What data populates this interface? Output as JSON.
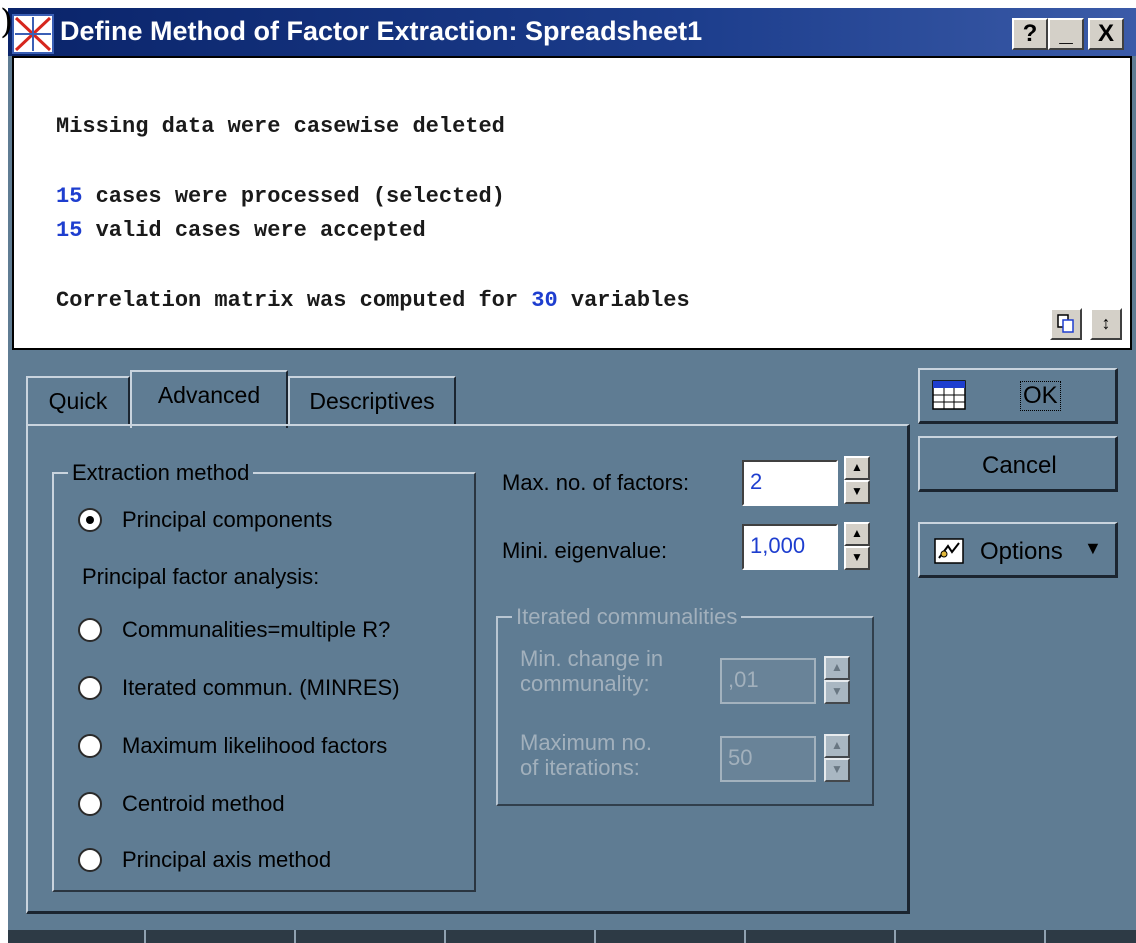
{
  "window": {
    "stray_char": ")",
    "title": "Define Method of Factor Extraction: Spreadsheet1",
    "help_label": "?",
    "minimize_label": "_",
    "close_label": "X"
  },
  "output": {
    "line1": "Missing data were casewise deleted",
    "line2_num": "15",
    "line2_text": " cases were processed (selected)",
    "line3_num": "15",
    "line3_text": " valid cases were accepted",
    "line4_text": "Correlation matrix was computed for ",
    "line4_num": "30",
    "line4_tail": " variables"
  },
  "tabs": [
    {
      "label": "Quick"
    },
    {
      "label": "Advanced"
    },
    {
      "label": "Descriptives"
    }
  ],
  "extraction": {
    "legend": "Extraction method",
    "principal_components": "Principal components",
    "pfa_label": "Principal factor analysis:",
    "options": [
      {
        "label": "Communalities=multiple R?"
      },
      {
        "label": "Iterated commun. (MINRES)"
      },
      {
        "label": "Maximum likelihood factors"
      },
      {
        "label": "Centroid method"
      },
      {
        "label": "Principal axis method"
      }
    ]
  },
  "params": {
    "max_factors_label": "Max. no. of factors:",
    "max_factors_value": "2",
    "min_eigen_label": "Mini. eigenvalue:",
    "min_eigen_value": "1,000"
  },
  "iterated": {
    "legend": "Iterated communalities",
    "min_change_label_1": "Min. change in",
    "min_change_label_2": "communality:",
    "min_change_value": ",01",
    "max_iter_label_1": "Maximum no.",
    "max_iter_label_2": "of iterations:",
    "max_iter_value": "50"
  },
  "buttons": {
    "ok": "OK",
    "cancel": "Cancel",
    "options": "Options"
  },
  "icons": [
    "app-icon",
    "copy-icon",
    "collapse-icon",
    "summary-grid-icon",
    "options-icon",
    "dropdown-arrow-icon"
  ]
}
